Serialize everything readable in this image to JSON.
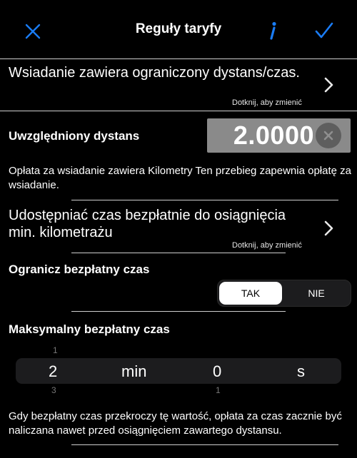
{
  "nav": {
    "title": "Reguły taryfy"
  },
  "rows": {
    "boarding_limit": {
      "title": "Wsiadanie zawiera ograniczony dystans/czas.",
      "hint": "Dotknij, aby zmienić"
    },
    "included_distance": {
      "label": "Uwzględniony dystans",
      "value": "2.0000"
    },
    "boarding_desc": "Opłata za wsiadanie zawiera Kilometry Ten przebieg zapewnia opłatę za wsiadanie.",
    "share_free_time": {
      "title": "Udostępniać czas bezpłatnie do osiągnięcia min. kilometrażu",
      "hint": "Dotknij, aby zmienić"
    },
    "limit_free_time": {
      "label": "Ogranicz bezpłatny czas",
      "options": [
        "TAK",
        "NIE"
      ],
      "selected": "TAK"
    },
    "max_free_time": {
      "label": "Maksymalny bezpłatny czas",
      "minutes": "2",
      "minutes_unit": "min",
      "seconds": "0",
      "seconds_unit": "s",
      "minutes_prev": "1",
      "minutes_next": "3",
      "seconds_next": "1"
    },
    "footer_desc": "Gdy bezpłatny czas przekroczy tę wartość, opłata za czas zacznie być naliczana nawet przed osiągnięciem zawartego dystansu."
  },
  "colors": {
    "accent": "#1a7cf5",
    "background": "#000000",
    "value_box": "#8a8a8a"
  },
  "icons": {
    "close": "close-icon",
    "info": "info-icon",
    "confirm": "checkmark-icon",
    "chevron": "chevron-right-icon",
    "clear": "clear-icon"
  }
}
